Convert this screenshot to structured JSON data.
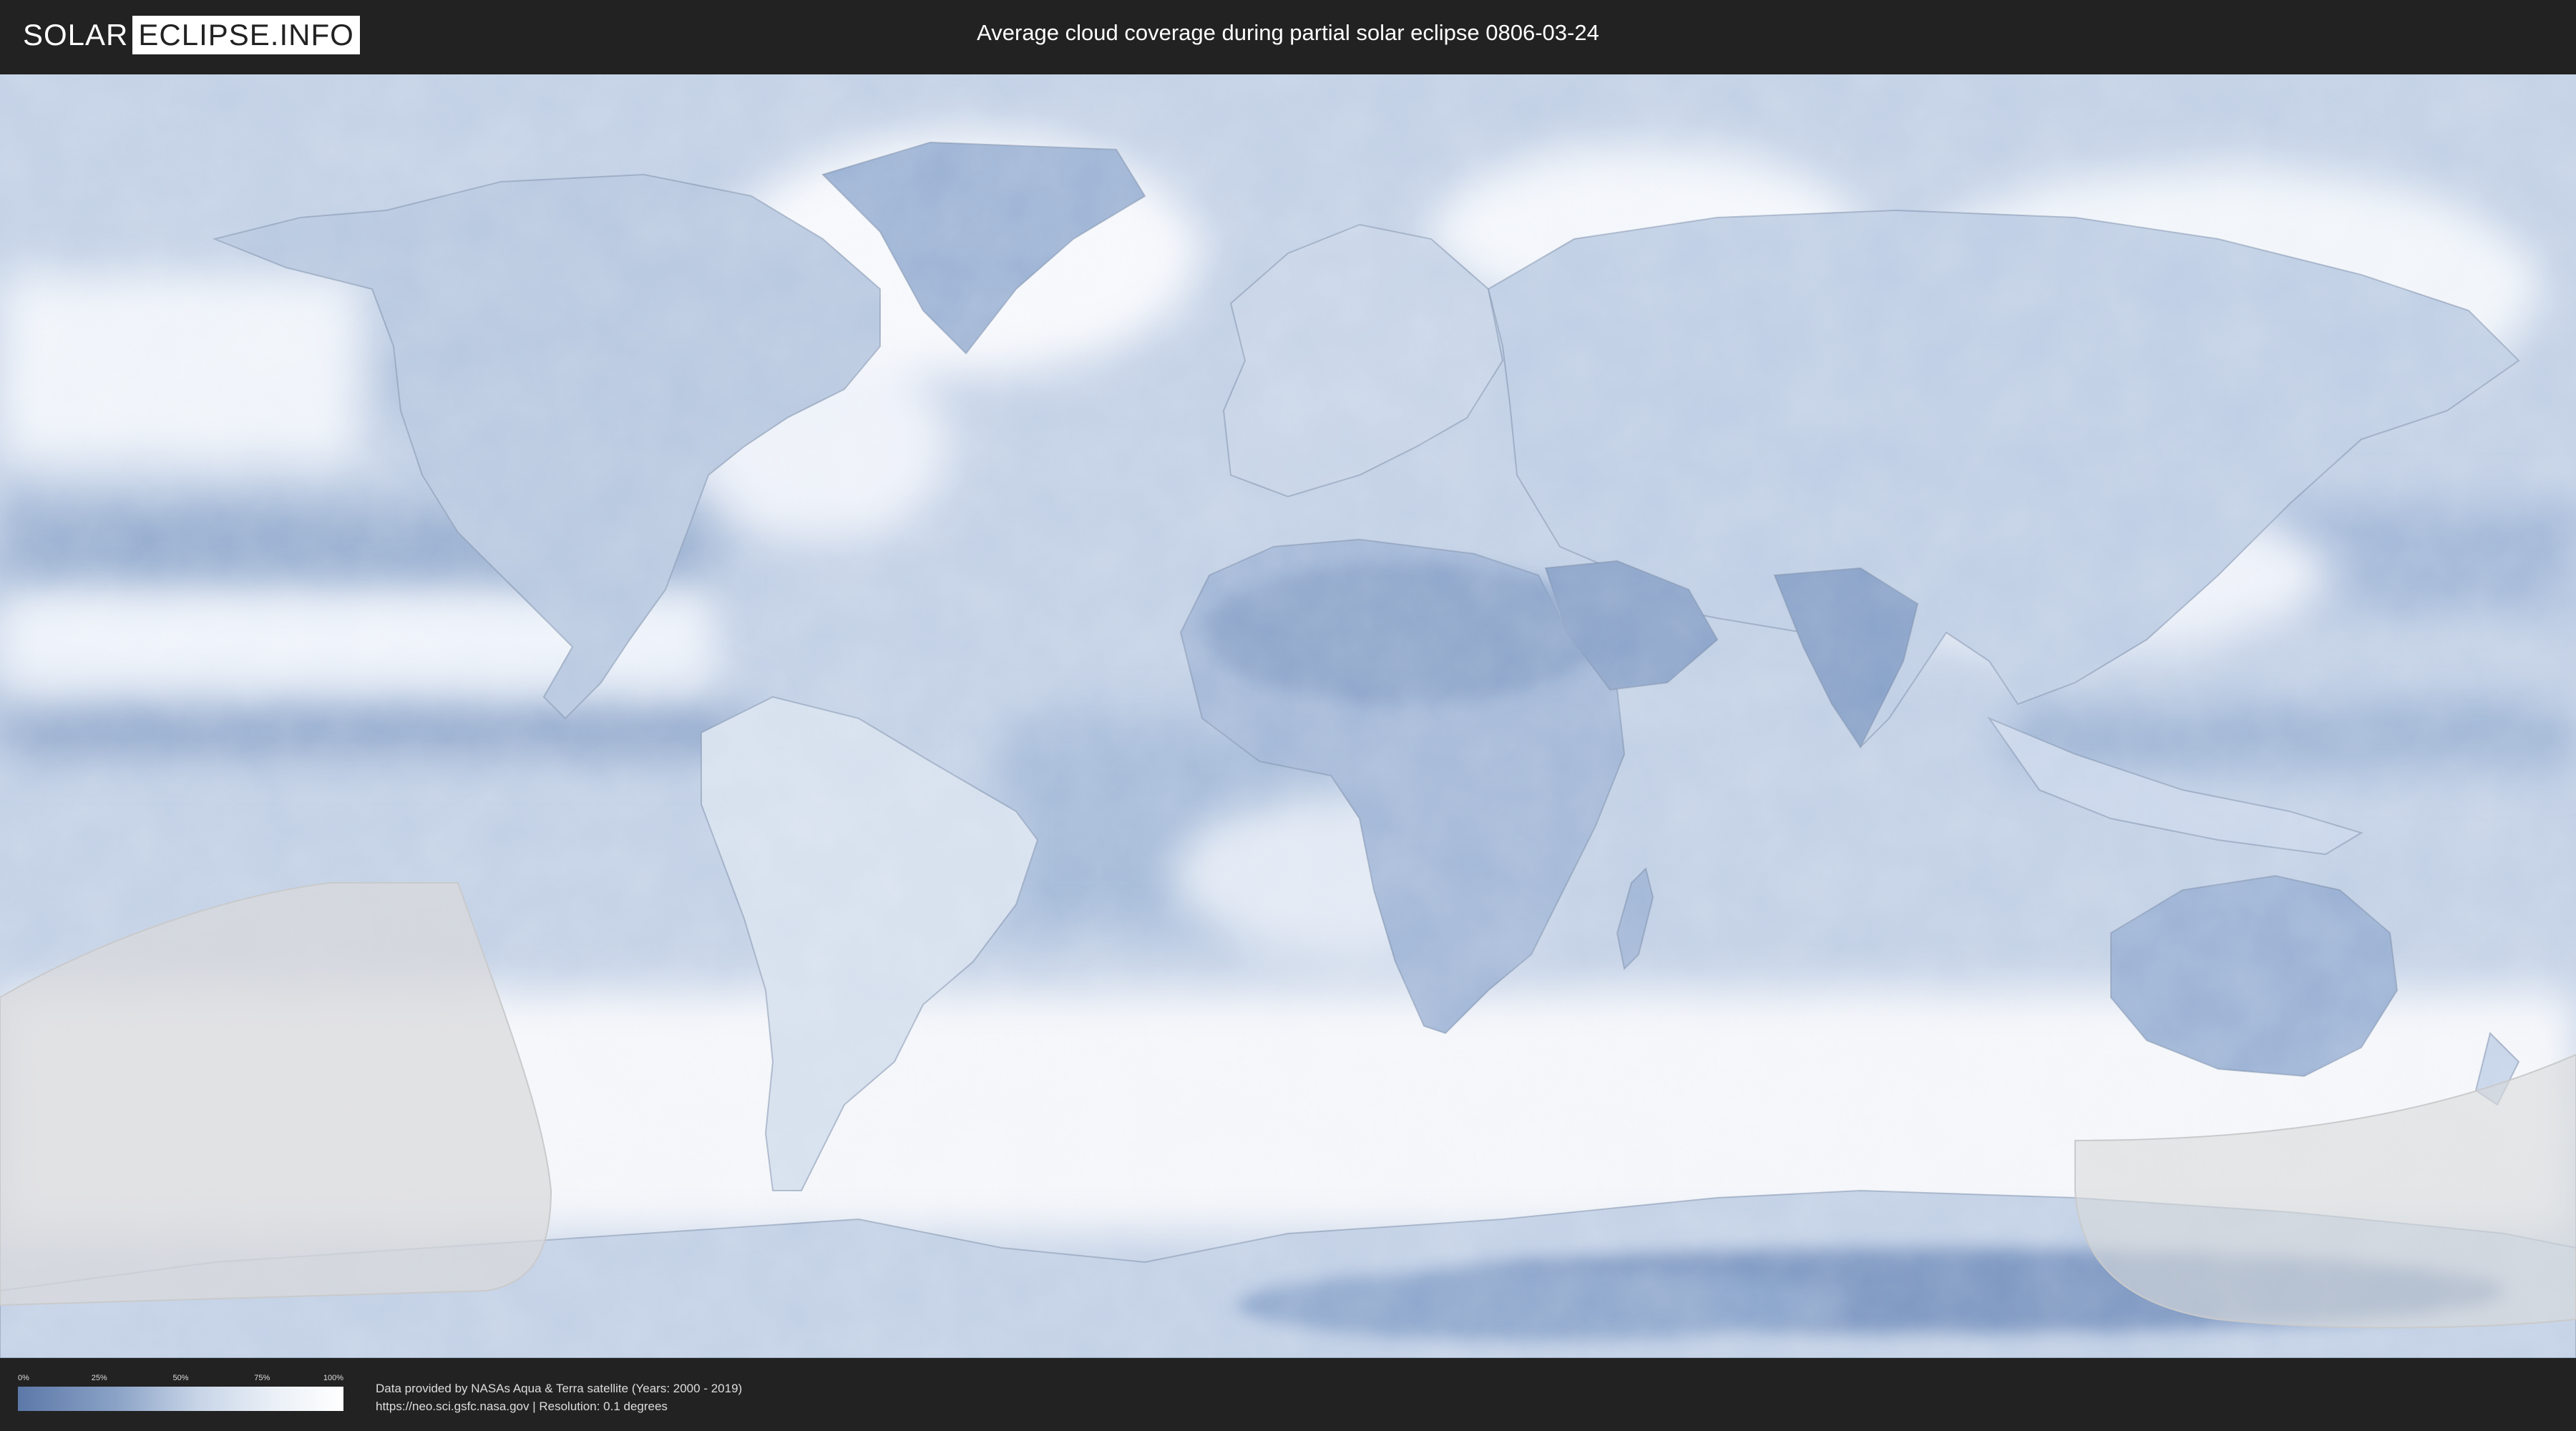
{
  "header": {
    "logo_left": "SOLAR",
    "logo_right": "ECLIPSE.INFO",
    "title": "Average cloud coverage during partial solar eclipse 0806-03-24"
  },
  "map": {
    "icon": "world-cloud-coverage-map",
    "colors": {
      "clear_sky": "#5c78a8",
      "cloudy": "#ffffff",
      "eclipse_overlay": "#d9dadb"
    },
    "eclipse_visibility_regions": [
      "south-pacific-west",
      "south-pacific-east"
    ]
  },
  "legend": {
    "ticks": [
      "0%",
      "25%",
      "50%",
      "75%",
      "100%"
    ],
    "colors": [
      "#5c78a8",
      "#8aa2c6",
      "#c7d4e7",
      "#ecf1f7",
      "#ffffff"
    ]
  },
  "credits": {
    "line1": "Data provided by NASAs Aqua & Terra satellite (Years: 2000 - 2019)",
    "line2": "https://neo.sci.gsfc.nasa.gov | Resolution: 0.1 degrees"
  }
}
